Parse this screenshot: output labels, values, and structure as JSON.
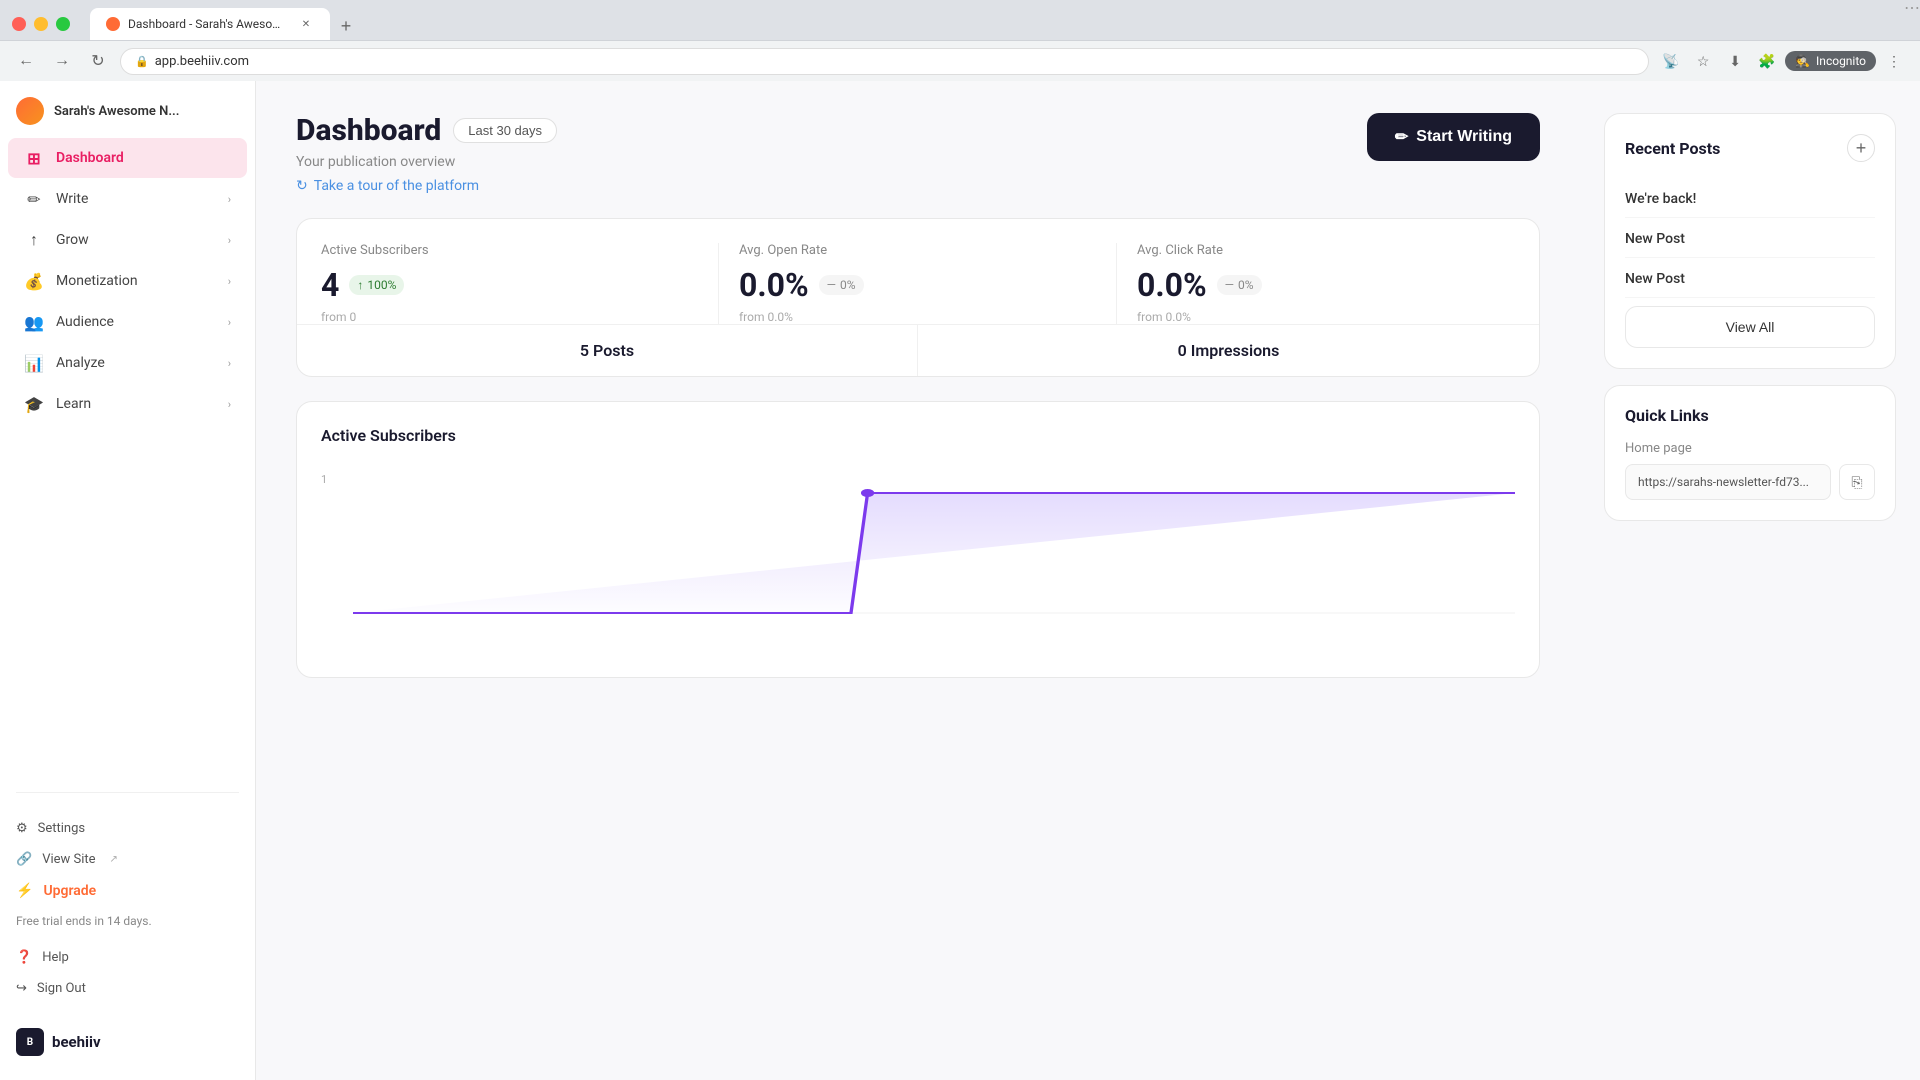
{
  "browser": {
    "tab_title": "Dashboard - Sarah's Awesome N...",
    "tab_favicon_color": "#ff6b35",
    "address": "app.beehiiv.com",
    "incognito_label": "Incognito"
  },
  "sidebar": {
    "publication_name": "Sarah's Awesome N...",
    "nav_items": [
      {
        "id": "dashboard",
        "label": "Dashboard",
        "icon": "⊞",
        "active": true,
        "has_chevron": false
      },
      {
        "id": "write",
        "label": "Write",
        "icon": "✏",
        "active": false,
        "has_chevron": true
      },
      {
        "id": "grow",
        "label": "Grow",
        "icon": "↑",
        "active": false,
        "has_chevron": true
      },
      {
        "id": "monetization",
        "label": "Monetization",
        "icon": "$",
        "active": false,
        "has_chevron": true
      },
      {
        "id": "audience",
        "label": "Audience",
        "icon": "👥",
        "active": false,
        "has_chevron": true
      },
      {
        "id": "analyze",
        "label": "Analyze",
        "icon": "📊",
        "active": false,
        "has_chevron": true
      },
      {
        "id": "learn",
        "label": "Learn",
        "icon": "🎓",
        "active": false,
        "has_chevron": true
      }
    ],
    "bottom_items": [
      {
        "id": "settings",
        "label": "Settings",
        "icon": "⚙"
      },
      {
        "id": "view-site",
        "label": "View Site",
        "icon": "🔗",
        "external": true
      },
      {
        "id": "upgrade",
        "label": "Upgrade",
        "icon": "⚡",
        "accent": true
      }
    ],
    "trial_text": "Free trial ends in 14 days.",
    "help_label": "Help",
    "sign_out_label": "Sign Out",
    "brand_name": "beehiiv"
  },
  "dashboard": {
    "title": "Dashboard",
    "period_badge": "Last 30 days",
    "subtitle": "Your publication overview",
    "tour_link": "Take a tour of the platform",
    "start_writing_label": "Start Writing",
    "stats": {
      "active_subscribers": {
        "label": "Active Subscribers",
        "value": "4",
        "badge_value": "100%",
        "badge_type": "positive",
        "from_label": "from 0"
      },
      "avg_open_rate": {
        "label": "Avg. Open Rate",
        "value": "0.0%",
        "badge_value": "0%",
        "badge_type": "neutral",
        "from_label": "from 0.0%"
      },
      "avg_click_rate": {
        "label": "Avg. Click Rate",
        "value": "0.0%",
        "badge_value": "0%",
        "badge_type": "neutral",
        "from_label": "from 0.0%"
      }
    },
    "posts_count": "5 Posts",
    "impressions_count": "0 Impressions",
    "chart_section_title": "Active Subscribers",
    "chart_y_value": "1"
  },
  "right_panel": {
    "recent_posts": {
      "title": "Recent Posts",
      "posts": [
        {
          "id": 1,
          "title": "We're back!"
        },
        {
          "id": 2,
          "title": "New Post"
        },
        {
          "id": 3,
          "title": "New Post"
        }
      ],
      "view_all_label": "View All"
    },
    "quick_links": {
      "title": "Quick Links",
      "home_page_label": "Home page",
      "home_page_url": "https://sarahs-newsletter-fd73..."
    }
  }
}
